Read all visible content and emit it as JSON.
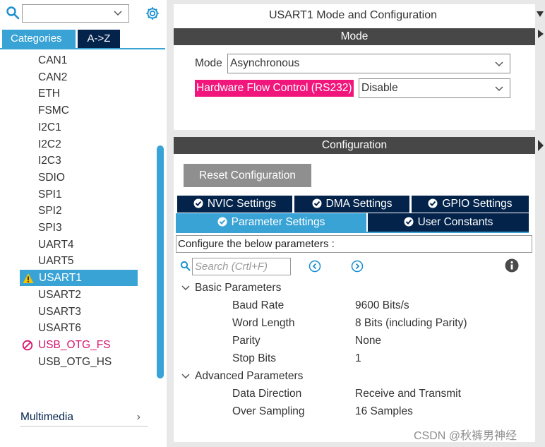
{
  "left": {
    "search_placeholder": "",
    "tabs": {
      "categories": "Categories",
      "az": "A->Z"
    },
    "peripherals": [
      {
        "label": "CAN1",
        "state": "normal"
      },
      {
        "label": "CAN2",
        "state": "normal"
      },
      {
        "label": "ETH",
        "state": "normal"
      },
      {
        "label": "FSMC",
        "state": "normal"
      },
      {
        "label": "I2C1",
        "state": "normal"
      },
      {
        "label": "I2C2",
        "state": "normal"
      },
      {
        "label": "I2C3",
        "state": "normal"
      },
      {
        "label": "SDIO",
        "state": "normal"
      },
      {
        "label": "SPI1",
        "state": "normal"
      },
      {
        "label": "SPI2",
        "state": "normal"
      },
      {
        "label": "SPI3",
        "state": "normal"
      },
      {
        "label": "UART4",
        "state": "normal"
      },
      {
        "label": "UART5",
        "state": "normal"
      },
      {
        "label": "USART1",
        "state": "selected-warning"
      },
      {
        "label": "USART2",
        "state": "normal"
      },
      {
        "label": "USART3",
        "state": "normal"
      },
      {
        "label": "USART6",
        "state": "normal"
      },
      {
        "label": "USB_OTG_FS",
        "state": "disabled"
      },
      {
        "label": "USB_OTG_HS",
        "state": "normal"
      }
    ],
    "category_footer": "Multimedia",
    "icons": {
      "search": "search-icon",
      "settings": "gear-icon",
      "expand": "chevron-right-icon"
    }
  },
  "mode": {
    "title": "USART1 Mode and Configuration",
    "header": "Mode",
    "mode_label": "Mode",
    "mode_value": "Asynchronous",
    "hfc_label": "Hardware Flow Control (RS232)",
    "hfc_value": "Disable"
  },
  "config": {
    "header": "Configuration",
    "reset_label": "Reset Configuration",
    "tabs": {
      "nvic": "NVIC Settings",
      "dma": "DMA Settings",
      "gpio": "GPIO Settings",
      "param": "Parameter Settings",
      "user": "User Constants"
    },
    "hint": "Configure the below parameters :",
    "search_placeholder": "Search (Crtl+F)",
    "groups": {
      "basic": "Basic Parameters",
      "advanced": "Advanced Parameters"
    },
    "basic_params": [
      {
        "name": "Baud Rate",
        "value": "9600 Bits/s"
      },
      {
        "name": "Word Length",
        "value": "8 Bits (including Parity)"
      },
      {
        "name": "Parity",
        "value": "None"
      },
      {
        "name": "Stop Bits",
        "value": "1"
      }
    ],
    "advanced_params": [
      {
        "name": "Data Direction",
        "value": "Receive and Transmit"
      },
      {
        "name": "Over Sampling",
        "value": "16 Samples"
      }
    ]
  },
  "colors": {
    "accent": "#39a3d6",
    "navy": "#03234b",
    "header_gray": "#474747",
    "highlight_pink": "#f0167c",
    "disabled_pink": "#d4146e",
    "warning": "#f5c400"
  },
  "watermark": "CSDN @秋裤男神经"
}
